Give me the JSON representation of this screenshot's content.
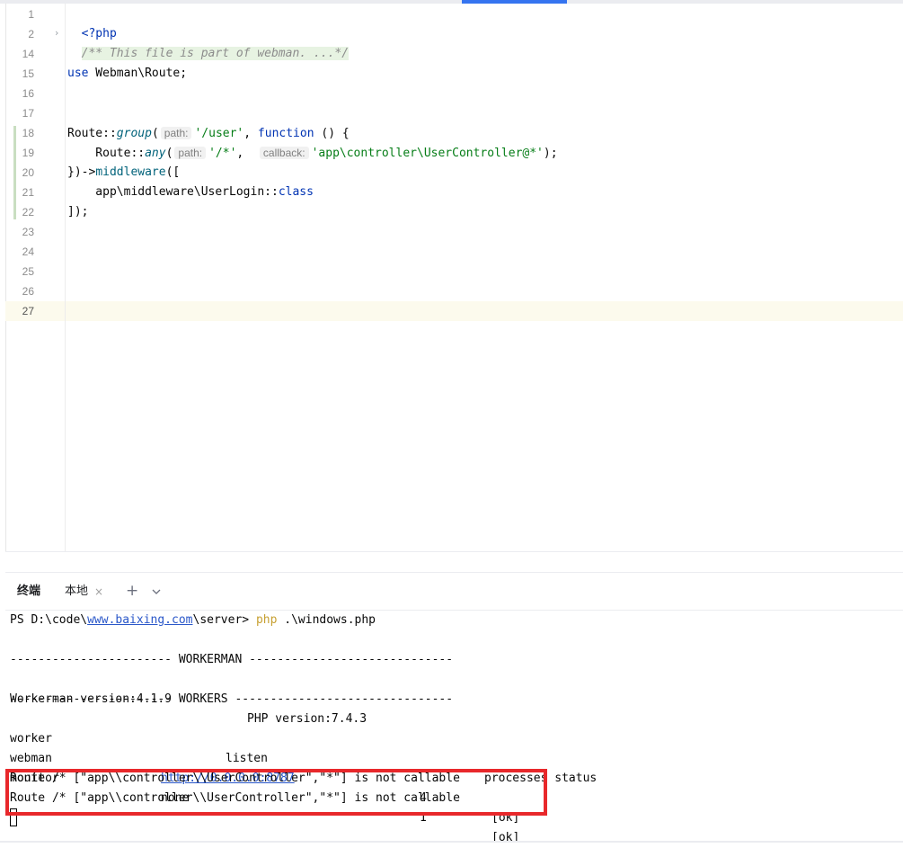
{
  "editor": {
    "line_numbers": [
      "1",
      "2",
      "14",
      "15",
      "16",
      "17",
      "18",
      "19",
      "20",
      "21",
      "22",
      "23",
      "24",
      "25",
      "26",
      "27"
    ],
    "code": {
      "l1": "<?php",
      "l2_comment": "/** This file is part of webman. ...*/",
      "l15_kw": "use",
      "l15_rest": " Webman\\Route;",
      "l18": {
        "a": "Route::",
        "b": "group",
        "c": "(",
        "hint_path": "path:",
        "str1": "'/user'",
        "d": ", ",
        "kw": "function",
        "e": " () {"
      },
      "l19": {
        "a": "    Route::",
        "b": "any",
        "c": "(",
        "hint_path": "path:",
        "str1": "'/*'",
        "d": ",  ",
        "hint_callback": "callback:",
        "str2": "'app\\controller\\UserController@*'",
        "e": ");"
      },
      "l20": {
        "a": "})->",
        "b": "middleware",
        "c": "(["
      },
      "l21": {
        "a": "    app\\middleware\\UserLogin::",
        "kw": "class"
      },
      "l22": "]);"
    }
  },
  "terminal": {
    "tab_title": "终端",
    "tab_local": "本地",
    "close_glyph": "×",
    "plus_glyph": "+",
    "prompt": {
      "a": "PS D:\\code\\",
      "link": "www.baixing.com",
      "b": "\\server> ",
      "php": "php",
      "c": " .\\windows.php"
    },
    "lines": {
      "sep1": "----------------------- WORKERMAN -----------------------------",
      "version_a": "Workerman version:4.1.9",
      "version_b": "PHP version:7.4.3",
      "sep2": "----------------------- WORKERS -------------------------------",
      "hdr_worker": "worker",
      "hdr_listen": "listen",
      "hdr_proc": "processes status",
      "r1_name": "webman",
      "r1_listen": "http://0.0.0.0:8787",
      "r1_proc": "4",
      "r1_status": "[ok]",
      "r2_name": "monitor",
      "r2_listen": "none",
      "r2_proc": "1",
      "r2_status": "[ok]",
      "err1": "Route /* [\"app\\\\controller\\\\UserController\",\"*\"] is not callable",
      "err2": "Route /* [\"app\\\\controller\\\\UserController\",\"*\"] is not callable"
    }
  },
  "colors": {
    "highlight_box": "#e8282b",
    "keyword": "#0033b3",
    "string": "#067d17",
    "link": "#2a57c9"
  }
}
